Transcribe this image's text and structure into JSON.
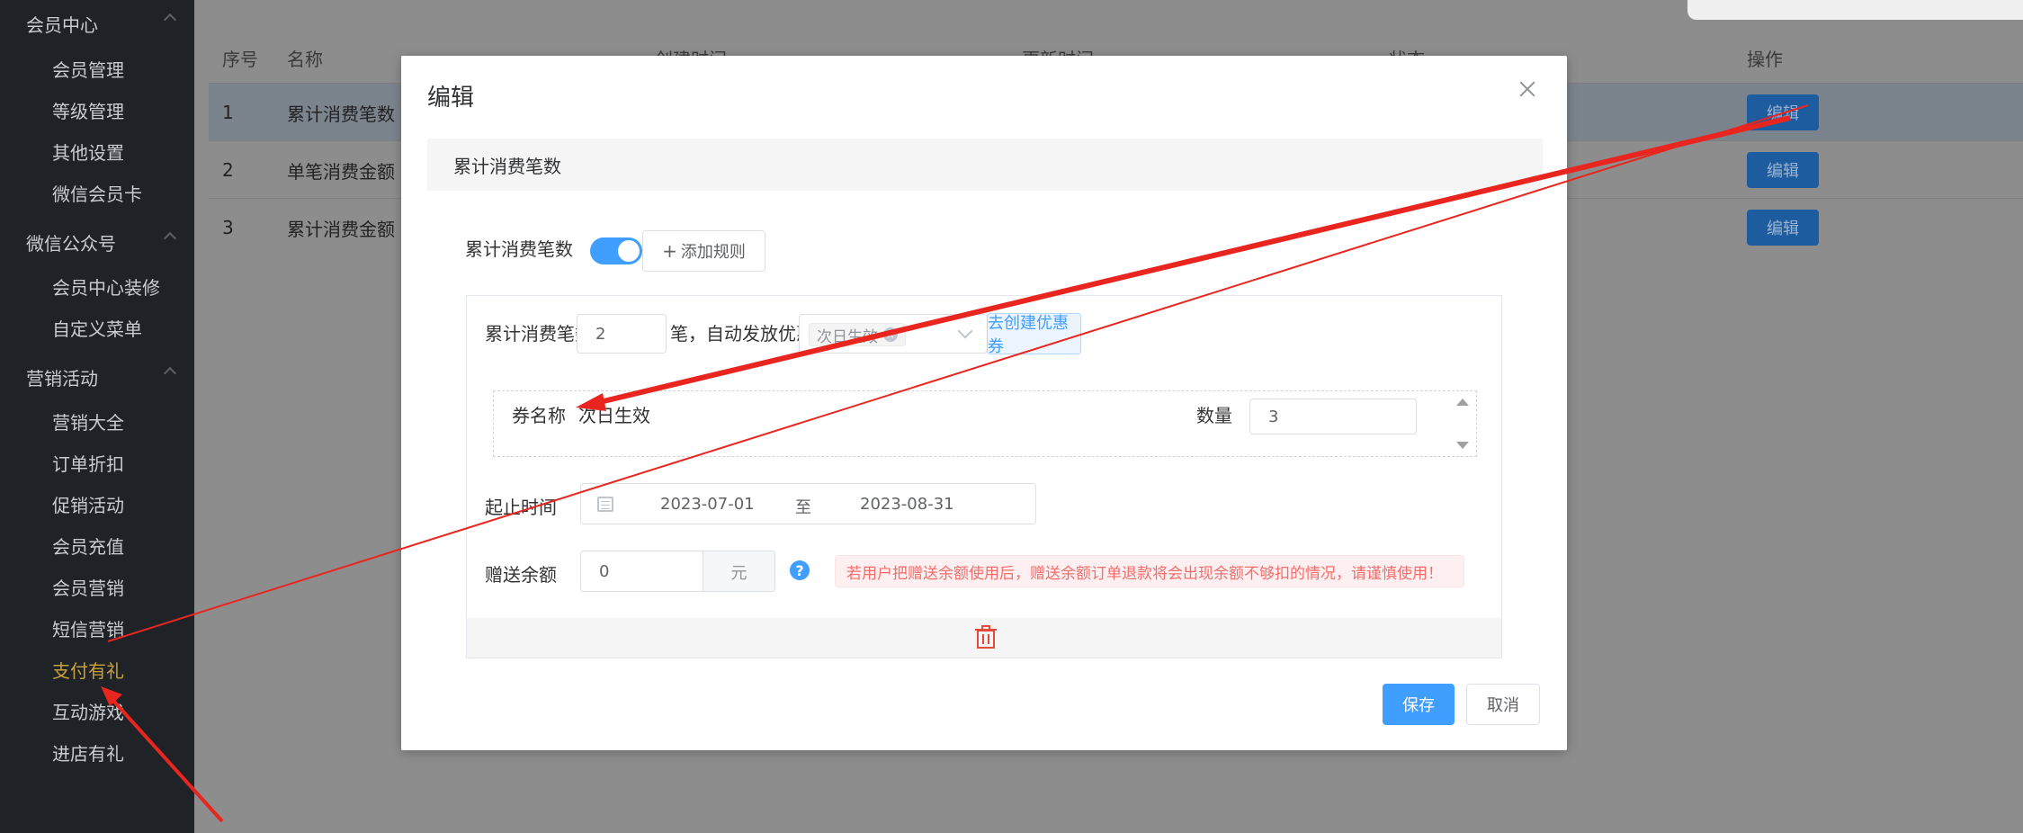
{
  "sidebar": {
    "groups": [
      {
        "label": "会员中心",
        "items": [
          "会员管理",
          "等级管理",
          "其他设置",
          "微信会员卡"
        ]
      },
      {
        "label": "微信公众号",
        "items": [
          "会员中心装修",
          "自定义菜单"
        ]
      },
      {
        "label": "营销活动",
        "items": [
          "营销大全",
          "订单折扣",
          "促销活动",
          "会员充值",
          "会员营销",
          "短信营销",
          "支付有礼",
          "互动游戏",
          "进店有礼"
        ]
      }
    ],
    "active_item": "支付有礼"
  },
  "table": {
    "columns": [
      "序号",
      "名称",
      "创建时间",
      "更新时间",
      "状态",
      "操作"
    ],
    "rows": [
      {
        "no": "1",
        "name": "累计消费笔数",
        "action": "编辑"
      },
      {
        "no": "2",
        "name": "单笔消费金额",
        "action": "编辑"
      },
      {
        "no": "3",
        "name": "累计消费金额",
        "action": "编辑"
      }
    ]
  },
  "modal": {
    "title": "编辑",
    "section_title": "累计消费笔数",
    "rule_switch_label": "累计消费笔数",
    "rule_switch_on": true,
    "add_rule_label": "添加规则",
    "rule": {
      "threshold_prefix": "累计消费笔数满",
      "threshold_value": "2",
      "threshold_suffix": "笔，自动发放优惠券",
      "selected_coupon_tag": "次日生效",
      "create_coupon_label": "去创建优惠券",
      "coupon_name_label": "券名称",
      "coupon_name_value": "次日生效",
      "quantity_label": "数量",
      "quantity_value": "3",
      "date_label": "起止时间",
      "date_start": "2023-07-01",
      "date_separator": "至",
      "date_end": "2023-08-31",
      "gift_label": "赠送余额",
      "gift_value": "0",
      "gift_unit": "元",
      "help_glyph": "?",
      "warning_text": "若用户把赠送余额使用后，赠送余额订单退款将会出现余额不够扣的情况，请谨慎使用！"
    },
    "save_label": "保存",
    "cancel_label": "取消"
  },
  "colors": {
    "primary": "#409eff",
    "danger": "#f56c6c",
    "sidebar_bg": "#1f2226",
    "sidebar_active": "#c9a23a",
    "annotation_arrow": "#e8261f"
  }
}
